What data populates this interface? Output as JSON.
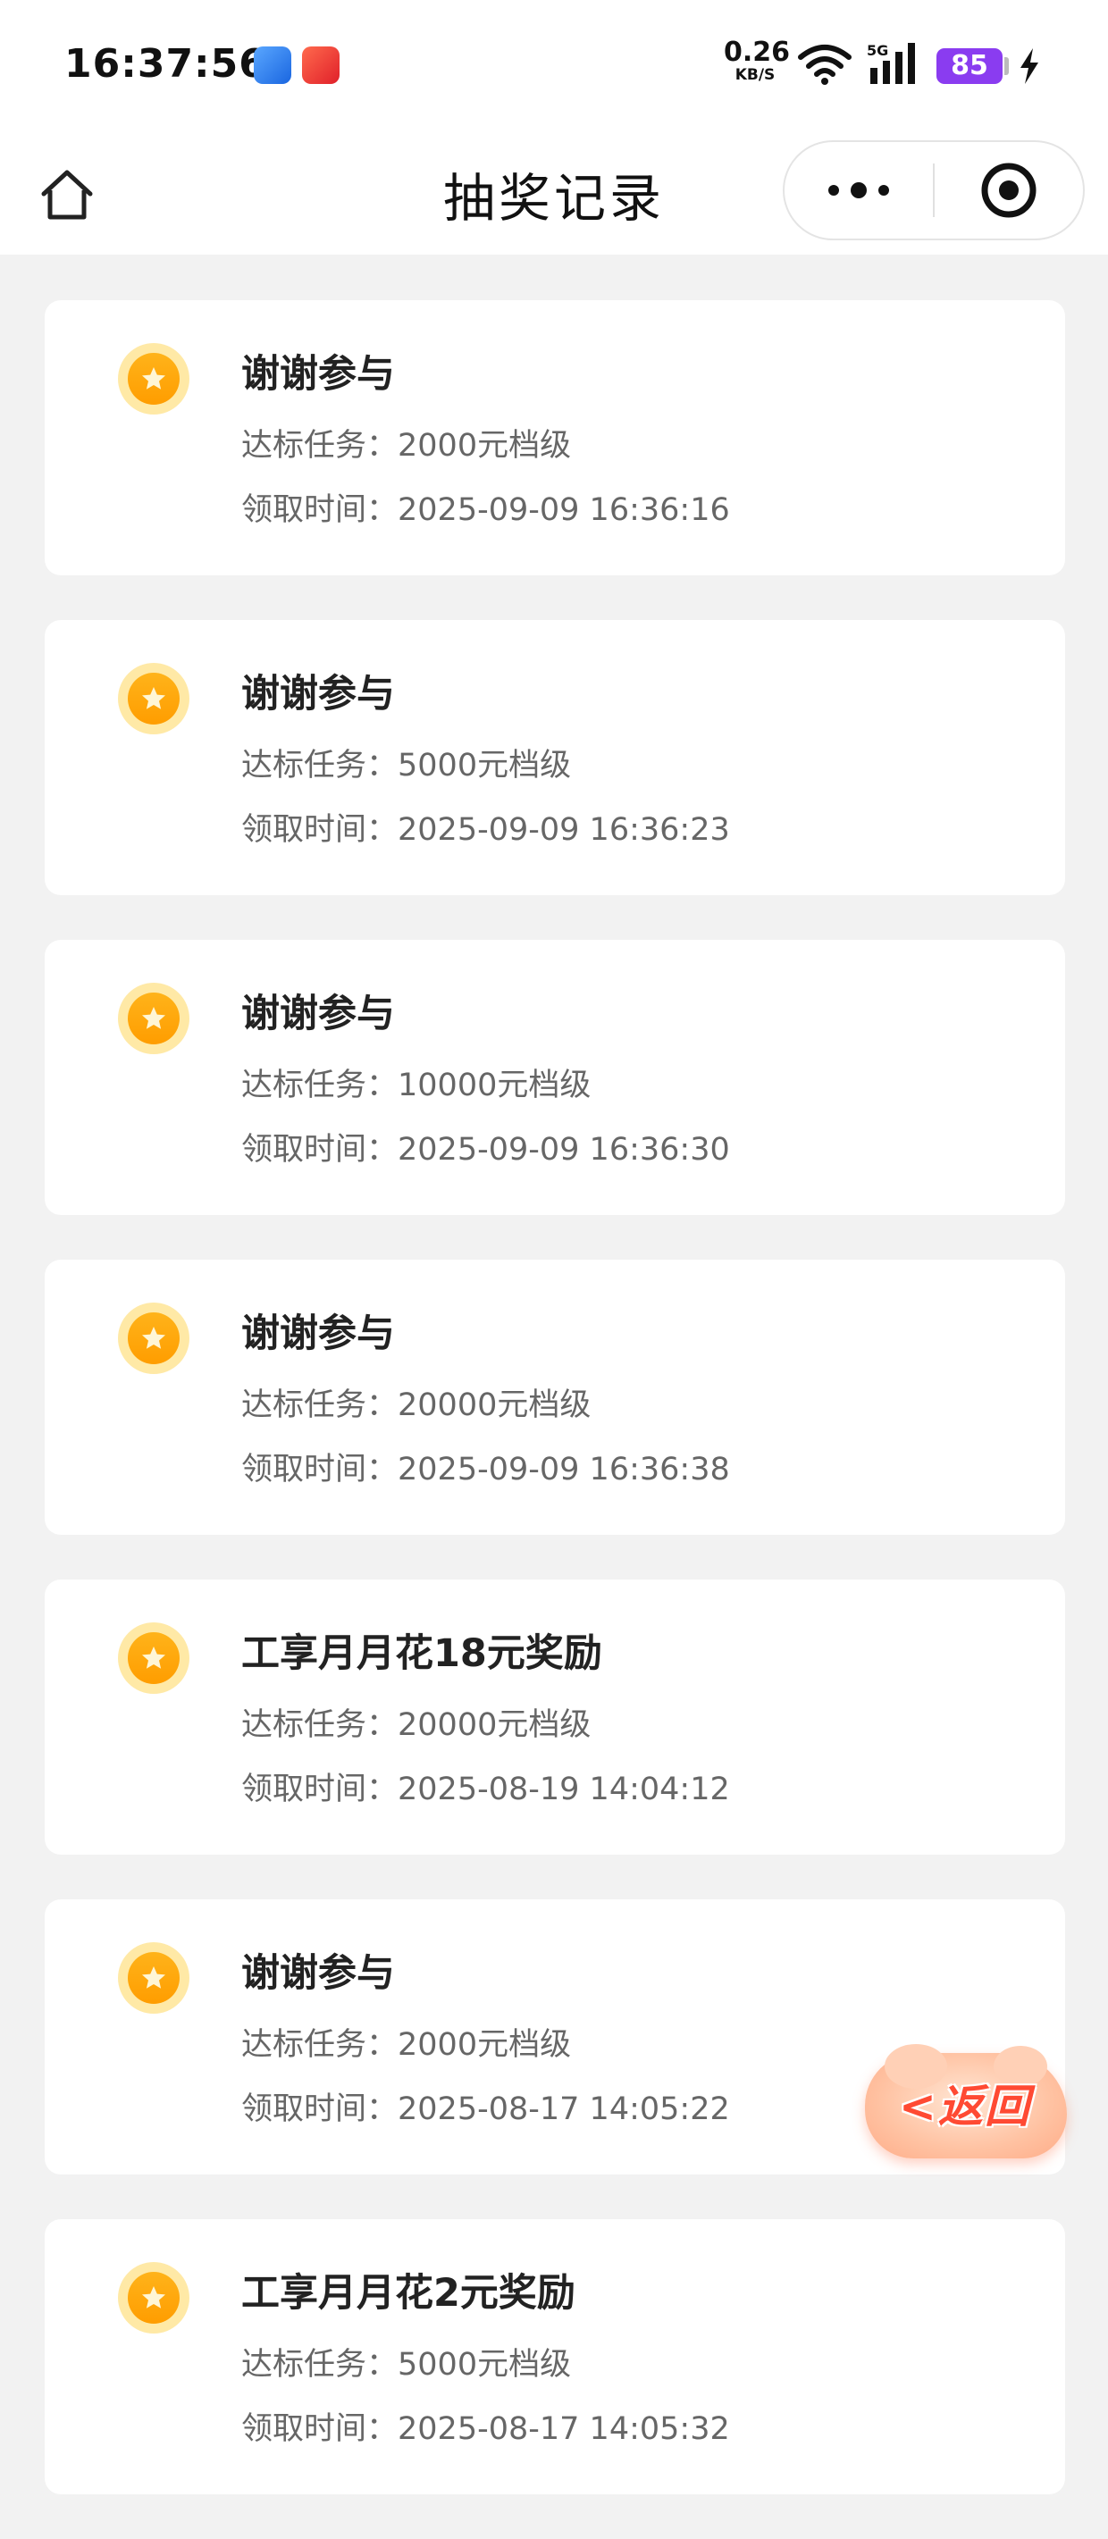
{
  "status_bar": {
    "time": "16:37:56",
    "net_speed_value": "0.26",
    "net_speed_unit": "KB/S",
    "network_type": "5G",
    "battery": "85",
    "app_icons": [
      "stock-app-icon",
      "shopping-app-icon"
    ]
  },
  "nav": {
    "title": "抽奖记录",
    "home_icon": "home-icon",
    "more_icon": "more-dots-icon",
    "close_icon": "target-close-icon"
  },
  "labels": {
    "task_prefix": "达标任务：",
    "time_prefix": "领取时间："
  },
  "records": [
    {
      "title": "谢谢参与",
      "task": "2000元档级",
      "time": "2025-09-09 16:36:16"
    },
    {
      "title": "谢谢参与",
      "task": "5000元档级",
      "time": "2025-09-09 16:36:23"
    },
    {
      "title": "谢谢参与",
      "task": "10000元档级",
      "time": "2025-09-09 16:36:30"
    },
    {
      "title": "谢谢参与",
      "task": "20000元档级",
      "time": "2025-09-09 16:36:38"
    },
    {
      "title": "工享月月花18元奖励",
      "task": "20000元档级",
      "time": "2025-08-19 14:04:12"
    },
    {
      "title": "谢谢参与",
      "task": "2000元档级",
      "time": "2025-08-17 14:05:22"
    },
    {
      "title": "工享月月花2元奖励",
      "task": "5000元档级",
      "time": "2025-08-17 14:05:32"
    }
  ],
  "float_button": {
    "label": "<返回"
  },
  "colors": {
    "coin": "#ff9d00",
    "coin_ring": "#ffe9a6",
    "battery": "#8a3cf0",
    "return_text": "#ff4a33"
  }
}
